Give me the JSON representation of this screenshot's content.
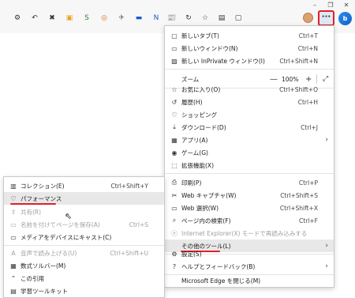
{
  "window": {
    "minimize": "–",
    "restore": "❐",
    "close": "✕"
  },
  "toolbar": {
    "icons": [
      "⚙",
      "↶",
      "✖",
      "▣",
      "S",
      "◎",
      "✈",
      "▬",
      "N",
      "📰",
      "↻",
      "☆",
      "▤",
      "▢"
    ],
    "menu_button": "···",
    "copilot": "b"
  },
  "menu": {
    "items": [
      {
        "icon": "▢",
        "label": "新しいタブ(T)",
        "shortcut": "Ctrl+T"
      },
      {
        "icon": "▭",
        "label": "新しいウィンドウ(N)",
        "shortcut": "Ctrl+N"
      },
      {
        "icon": "▨",
        "label": "新しい InPrivate ウィンドウ(I)",
        "shortcut": "Ctrl+Shift+N"
      },
      {
        "icon": "☆",
        "label": "お気に入り(O)",
        "shortcut": "Ctrl+Shift+O"
      },
      {
        "icon": "↺",
        "label": "履歴(H)",
        "shortcut": "Ctrl+H"
      },
      {
        "icon": "♡",
        "label": "ショッピング",
        "shortcut": ""
      },
      {
        "icon": "⤓",
        "label": "ダウンロード(D)",
        "shortcut": "Ctrl+J"
      },
      {
        "icon": "▦",
        "label": "アプリ(A)",
        "shortcut": ""
      },
      {
        "icon": "◉",
        "label": "ゲーム(G)",
        "shortcut": ""
      },
      {
        "icon": "⬚",
        "label": "拡張機能(X)",
        "shortcut": ""
      },
      {
        "icon": "⎙",
        "label": "印刷(P)",
        "shortcut": "Ctrl+P"
      },
      {
        "icon": "✂",
        "label": "Web キャプチャ(W)",
        "shortcut": "Ctrl+Shift+S"
      },
      {
        "icon": "▭",
        "label": "Web 選択(W)",
        "shortcut": "Ctrl+Shift+X"
      },
      {
        "icon": "⌕",
        "label": "ページ内の検索(F)",
        "shortcut": "Ctrl+F"
      },
      {
        "icon": "ⓔ",
        "label": "Internet Explorer(X) モードで再読み込みする",
        "shortcut": ""
      },
      {
        "icon": "",
        "label": "その他のツール(L)",
        "shortcut": ""
      },
      {
        "icon": "⚙",
        "label": "設定(S)",
        "shortcut": ""
      },
      {
        "icon": "?",
        "label": "ヘルプとフィードバック(B)",
        "shortcut": ""
      },
      {
        "icon": "",
        "label": "Microsoft Edge を閉じる(M)",
        "shortcut": ""
      }
    ],
    "zoom": {
      "label": "ズーム",
      "minus": "—",
      "value": "100%",
      "plus": "+",
      "fullscreen": "⤢"
    },
    "chevron": "›"
  },
  "submenu": {
    "items": [
      {
        "icon": "▥",
        "label": "コレクション(E)",
        "shortcut": "Ctrl+Shift+Y"
      },
      {
        "icon": "♡",
        "label": "パフォーマンス",
        "shortcut": ""
      },
      {
        "icon": "⇪",
        "label": "共有(R)",
        "shortcut": ""
      },
      {
        "icon": "▭",
        "label": "名前を付けてページを保存(A)",
        "shortcut": "Ctrl+S"
      },
      {
        "icon": "▭",
        "label": "メディアをデバイスにキャスト(C)",
        "shortcut": ""
      },
      {
        "icon": "A",
        "label": "音声で読み上げる(U)",
        "shortcut": "Ctrl+Shift+U"
      },
      {
        "icon": "▦",
        "label": "数式ソルバー(M)",
        "shortcut": ""
      },
      {
        "icon": "”",
        "label": "この引用",
        "shortcut": ""
      },
      {
        "icon": "▤",
        "label": "学習ツールキット",
        "shortcut": ""
      }
    ],
    "cursor": "⇖"
  },
  "colors": {
    "accent_red": "#e0202a",
    "menu_highlight": "#e8e8e8"
  }
}
